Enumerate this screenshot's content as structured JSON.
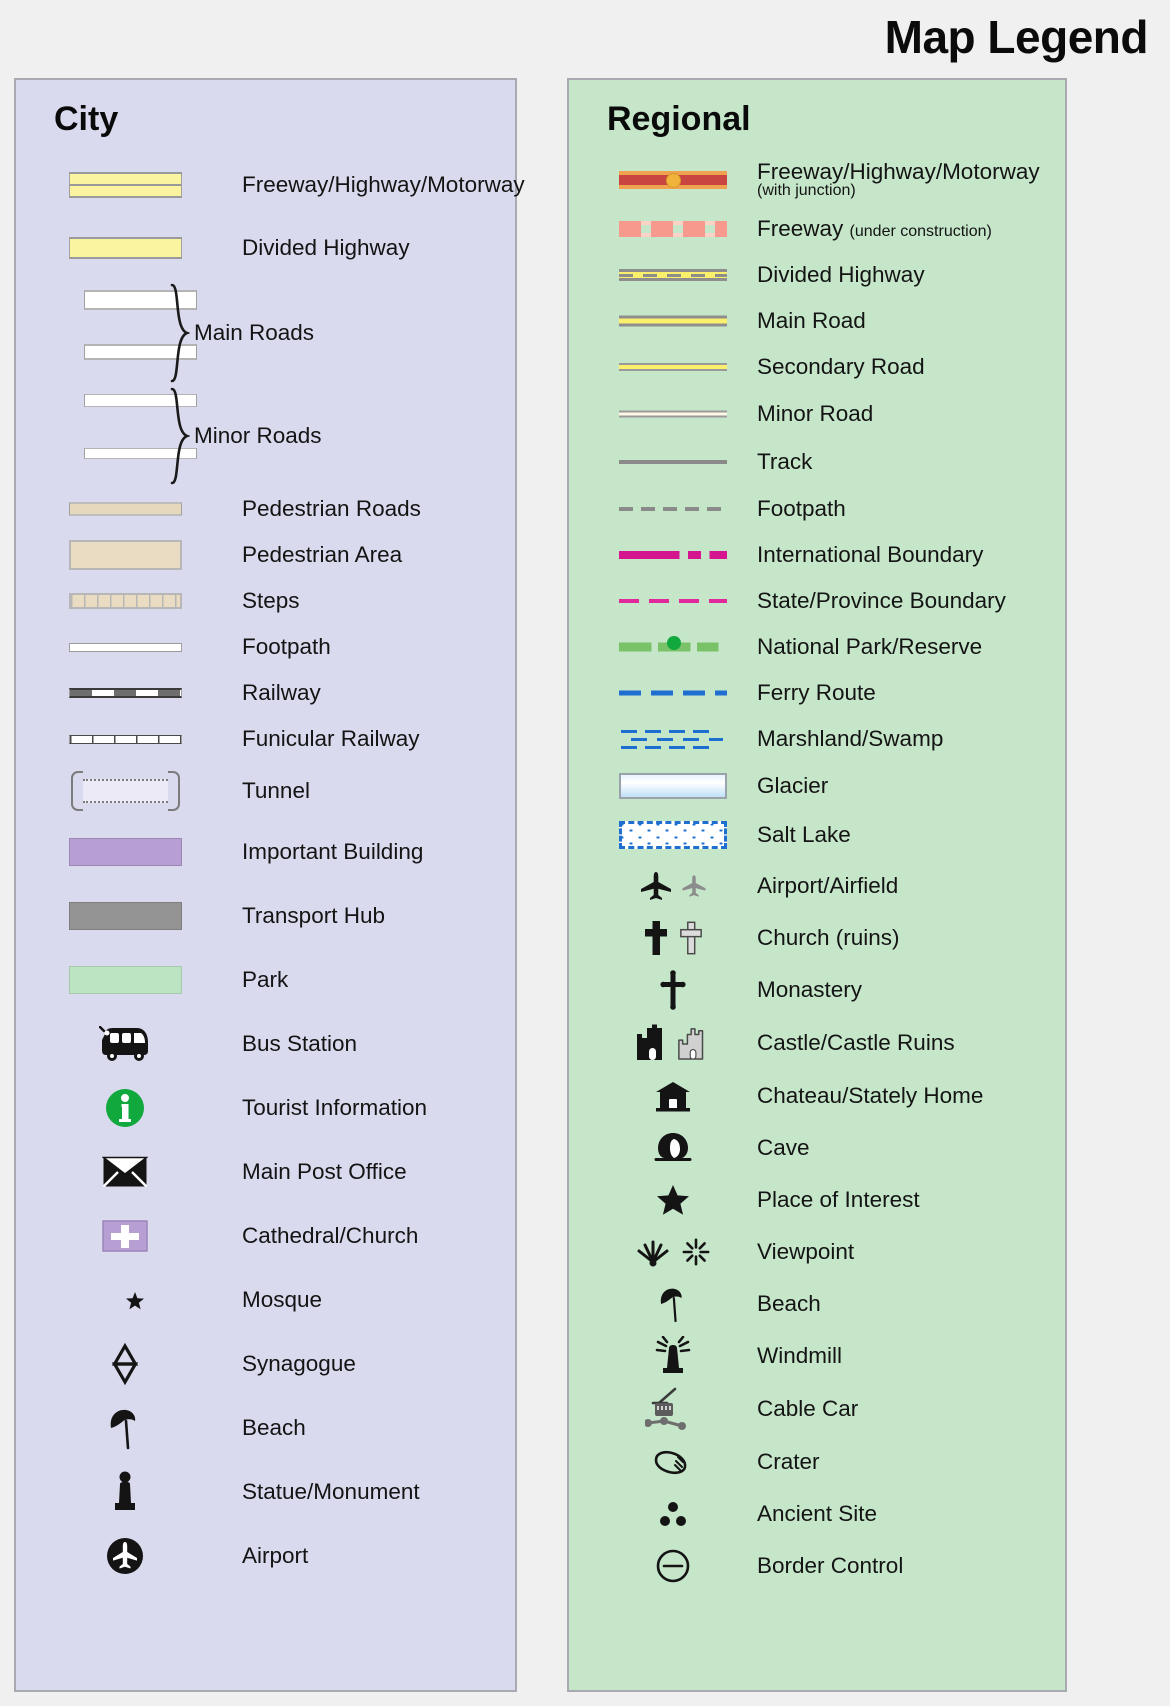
{
  "title": "Map Legend",
  "city": {
    "heading": "City",
    "items": [
      {
        "label": "Freeway/Highway/Motorway",
        "symbol": "city-freeway-swatch"
      },
      {
        "label": "Divided Highway",
        "symbol": "city-divided-highway-swatch"
      },
      {
        "label": "Main Roads",
        "symbol": "city-main-roads-braced-swatch"
      },
      {
        "label": "Minor Roads",
        "symbol": "city-minor-roads-braced-swatch"
      },
      {
        "label": "Pedestrian Roads",
        "symbol": "city-pedestrian-road-swatch"
      },
      {
        "label": "Pedestrian Area",
        "symbol": "city-pedestrian-area-swatch"
      },
      {
        "label": "Steps",
        "symbol": "city-steps-swatch"
      },
      {
        "label": "Footpath",
        "symbol": "city-footpath-swatch"
      },
      {
        "label": "Railway",
        "symbol": "city-railway-swatch"
      },
      {
        "label": "Funicular Railway",
        "symbol": "city-funicular-swatch"
      },
      {
        "label": "Tunnel",
        "symbol": "city-tunnel-swatch"
      },
      {
        "label": "Important Building",
        "symbol": "city-important-building-swatch"
      },
      {
        "label": "Transport Hub",
        "symbol": "city-transport-hub-swatch"
      },
      {
        "label": "Park",
        "symbol": "city-park-swatch"
      },
      {
        "label": "Bus Station",
        "symbol": "bus-icon"
      },
      {
        "label": "Tourist Information",
        "symbol": "information-icon"
      },
      {
        "label": "Main Post Office",
        "symbol": "envelope-icon"
      },
      {
        "label": "Cathedral/Church",
        "symbol": "cathedral-cross-icon"
      },
      {
        "label": "Mosque",
        "symbol": "crescent-star-icon"
      },
      {
        "label": "Synagogue",
        "symbol": "star-of-david-icon"
      },
      {
        "label": "Beach",
        "symbol": "beach-umbrella-icon"
      },
      {
        "label": "Statue/Monument",
        "symbol": "statue-icon"
      },
      {
        "label": "Airport",
        "symbol": "airport-circle-icon"
      }
    ]
  },
  "regional": {
    "heading": "Regional",
    "items": [
      {
        "label": "Freeway/Highway/Motorway",
        "sub": "(with junction)",
        "symbol": "regional-freeway-junction-swatch"
      },
      {
        "label": "Freeway",
        "inline": "(under construction)",
        "symbol": "regional-freeway-construction-swatch"
      },
      {
        "label": "Divided Highway",
        "symbol": "regional-divided-highway-swatch"
      },
      {
        "label": "Main Road",
        "symbol": "regional-main-road-swatch"
      },
      {
        "label": "Secondary Road",
        "symbol": "regional-secondary-road-swatch"
      },
      {
        "label": "Minor Road",
        "symbol": "regional-minor-road-swatch"
      },
      {
        "label": "Track",
        "symbol": "regional-track-swatch"
      },
      {
        "label": "Footpath",
        "symbol": "regional-footpath-swatch"
      },
      {
        "label": "International Boundary",
        "symbol": "international-boundary-swatch"
      },
      {
        "label": "State/Province Boundary",
        "symbol": "state-boundary-swatch"
      },
      {
        "label": "National Park/Reserve",
        "symbol": "national-park-swatch"
      },
      {
        "label": "Ferry Route",
        "symbol": "ferry-route-swatch"
      },
      {
        "label": "Marshland/Swamp",
        "symbol": "marshland-swatch"
      },
      {
        "label": "Glacier",
        "symbol": "glacier-swatch"
      },
      {
        "label": "Salt Lake",
        "symbol": "salt-lake-swatch"
      },
      {
        "label": "Airport/Airfield",
        "symbol": "airplane-icon"
      },
      {
        "label": "Church (ruins)",
        "symbol": "church-cross-icon"
      },
      {
        "label": "Monastery",
        "symbol": "monastery-cross-icon"
      },
      {
        "label": "Castle/Castle Ruins",
        "symbol": "castle-icon"
      },
      {
        "label": "Chateau/Stately Home",
        "symbol": "chateau-icon"
      },
      {
        "label": "Cave",
        "symbol": "cave-icon"
      },
      {
        "label": "Place of Interest",
        "symbol": "star-icon"
      },
      {
        "label": "Viewpoint",
        "symbol": "viewpoint-icon"
      },
      {
        "label": "Beach",
        "symbol": "beach-umbrella-icon"
      },
      {
        "label": "Windmill",
        "symbol": "windmill-icon"
      },
      {
        "label": "Cable Car",
        "symbol": "cable-car-icon"
      },
      {
        "label": "Crater",
        "symbol": "crater-icon"
      },
      {
        "label": "Ancient Site",
        "symbol": "ancient-site-icon"
      },
      {
        "label": "Border Control",
        "symbol": "border-control-icon"
      }
    ]
  },
  "colors": {
    "page_background": "#f0f0f0",
    "city_panel": "#d9daee",
    "regional_panel": "#c6e6ca",
    "panel_border": "#a9a9b2",
    "highway_yellow": "#faf4a0",
    "regional_road_yellow": "#fbf06b",
    "freeway_red": "#c9453f",
    "freeway_orange": "#f0a24e",
    "junction_dot": "#f0b33c",
    "freeway_under_construction": "#f79a8d",
    "pedestrian_tan": "#e9dcc2",
    "important_building_purple": "#b79fd4",
    "transport_hub_grey": "#949494",
    "park_green": "#bde4c2",
    "tourist_info_green": "#11a83e",
    "boundary_magenta": "#d6168f",
    "national_park_green": "#79c268",
    "water_blue": "#1f6fd0",
    "track_grey": "#8a8a8a",
    "icon_black": "#1a1a1a",
    "ruins_grey": "#c9c9c9"
  }
}
